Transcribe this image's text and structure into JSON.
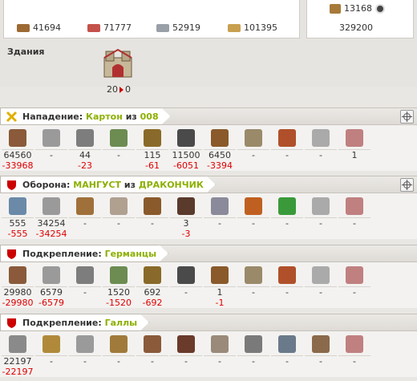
{
  "resources": {
    "wood": "41694",
    "clay": "71777",
    "iron": "52919",
    "crop": "101395"
  },
  "crop_box": {
    "value": "13168",
    "production": "329200"
  },
  "buildings": {
    "label": "Здания",
    "count": "20",
    "destroyed": "0"
  },
  "sections": [
    {
      "role": "Нападение:",
      "player": "Картон",
      "sep": "из",
      "village": "008",
      "icon": "crossed-swords-icon",
      "units": [
        {
          "icon": "club-icon",
          "color": "#8a5a3a",
          "count": "64560",
          "loss": "-33968"
        },
        {
          "icon": "spear-icon",
          "color": "#9a9a9a",
          "count": "-",
          "loss": ""
        },
        {
          "icon": "axe-icon",
          "color": "#7d7d7d",
          "count": "44",
          "loss": "-23"
        },
        {
          "icon": "scout-icon",
          "color": "#6c8c52",
          "count": "-",
          "loss": ""
        },
        {
          "icon": "paladin-icon",
          "color": "#8a6a2a",
          "count": "115",
          "loss": "-61"
        },
        {
          "icon": "teutonic-knight-icon",
          "color": "#4a4a4a",
          "count": "11500",
          "loss": "-6051"
        },
        {
          "icon": "ram-icon",
          "color": "#8a5a2a",
          "count": "6450",
          "loss": "-3394"
        },
        {
          "icon": "catapult-icon",
          "color": "#9a8a6a",
          "count": "-",
          "loss": ""
        },
        {
          "icon": "chief-icon",
          "color": "#b0502a",
          "count": "-",
          "loss": ""
        },
        {
          "icon": "settler-icon",
          "color": "#aaaaaa",
          "count": "-",
          "loss": ""
        },
        {
          "icon": "hero-icon",
          "color": "#c08080",
          "count": "1",
          "loss": ""
        }
      ]
    },
    {
      "role": "Оборона:",
      "player": "МАНГУСТ",
      "sep": "из",
      "village": "ДРАКОНЧИК",
      "icon": "shield-icon",
      "gear": true,
      "units": [
        {
          "icon": "legionnaire-icon",
          "color": "#6a8aa8",
          "count": "555",
          "loss": "-555"
        },
        {
          "icon": "praetorian-icon",
          "color": "#9a9a9a",
          "count": "34254",
          "loss": "-34254"
        },
        {
          "icon": "imperian-icon",
          "color": "#a0703a",
          "count": "-",
          "loss": ""
        },
        {
          "icon": "equites-legati-icon",
          "color": "#b0a090",
          "count": "-",
          "loss": ""
        },
        {
          "icon": "equites-imperatoris-icon",
          "color": "#8a5a2a",
          "count": "-",
          "loss": ""
        },
        {
          "icon": "equites-caesaris-icon",
          "color": "#5a3a2a",
          "count": "3",
          "loss": "-3"
        },
        {
          "icon": "battering-ram-icon",
          "color": "#8a8a9a",
          "count": "-",
          "loss": ""
        },
        {
          "icon": "fire-catapult-icon",
          "color": "#c06020",
          "count": "-",
          "loss": ""
        },
        {
          "icon": "senator-icon",
          "color": "#3a9a3a",
          "count": "-",
          "loss": ""
        },
        {
          "icon": "settler-icon",
          "color": "#aaaaaa",
          "count": "-",
          "loss": ""
        },
        {
          "icon": "hero-icon",
          "color": "#c08080",
          "count": "-",
          "loss": ""
        }
      ]
    },
    {
      "role": "Подкрепление:",
      "player": "Германцы",
      "sep": "",
      "village": "",
      "icon": "shield-icon",
      "units": [
        {
          "icon": "club-icon",
          "color": "#8a5a3a",
          "count": "29980",
          "loss": "-29980"
        },
        {
          "icon": "spear-icon",
          "color": "#9a9a9a",
          "count": "6579",
          "loss": "-6579"
        },
        {
          "icon": "axe-icon",
          "color": "#7d7d7d",
          "count": "-",
          "loss": ""
        },
        {
          "icon": "scout-icon",
          "color": "#6c8c52",
          "count": "1520",
          "loss": "-1520"
        },
        {
          "icon": "paladin-icon",
          "color": "#8a6a2a",
          "count": "692",
          "loss": "-692"
        },
        {
          "icon": "teutonic-knight-icon",
          "color": "#4a4a4a",
          "count": "-",
          "loss": ""
        },
        {
          "icon": "ram-icon",
          "color": "#8a5a2a",
          "count": "1",
          "loss": "-1"
        },
        {
          "icon": "catapult-icon",
          "color": "#9a8a6a",
          "count": "-",
          "loss": ""
        },
        {
          "icon": "chief-icon",
          "color": "#b0502a",
          "count": "-",
          "loss": ""
        },
        {
          "icon": "settler-icon",
          "color": "#aaaaaa",
          "count": "-",
          "loss": ""
        },
        {
          "icon": "hero-icon",
          "color": "#c08080",
          "count": "-",
          "loss": ""
        }
      ]
    },
    {
      "role": "Подкрепление:",
      "player": "Галлы",
      "sep": "",
      "village": "",
      "icon": "shield-icon",
      "units": [
        {
          "icon": "phalanx-icon",
          "color": "#8a8a8a",
          "count": "22197",
          "loss": "-22197"
        },
        {
          "icon": "swordsman-icon",
          "color": "#b08a3a",
          "count": "-",
          "loss": ""
        },
        {
          "icon": "pathfinder-icon",
          "color": "#9a9a9a",
          "count": "-",
          "loss": ""
        },
        {
          "icon": "theutates-thunder-icon",
          "color": "#a07a3a",
          "count": "-",
          "loss": ""
        },
        {
          "icon": "druidrider-icon",
          "color": "#8a5a3a",
          "count": "-",
          "loss": ""
        },
        {
          "icon": "haeduan-icon",
          "color": "#6a3a2a",
          "count": "-",
          "loss": ""
        },
        {
          "icon": "gaul-ram-icon",
          "color": "#9a8a7a",
          "count": "-",
          "loss": ""
        },
        {
          "icon": "trebuchet-icon",
          "color": "#7a7a7a",
          "count": "-",
          "loss": ""
        },
        {
          "icon": "gaul-chieftain-icon",
          "color": "#6a7a8a",
          "count": "-",
          "loss": ""
        },
        {
          "icon": "gaul-settler-icon",
          "color": "#8a6a4a",
          "count": "-",
          "loss": ""
        },
        {
          "icon": "hero-icon",
          "color": "#c08080",
          "count": "-",
          "loss": ""
        }
      ]
    }
  ],
  "colors": {
    "loss": "#dd0000",
    "highlight": "#8cb000",
    "shield": "#cc0000"
  }
}
